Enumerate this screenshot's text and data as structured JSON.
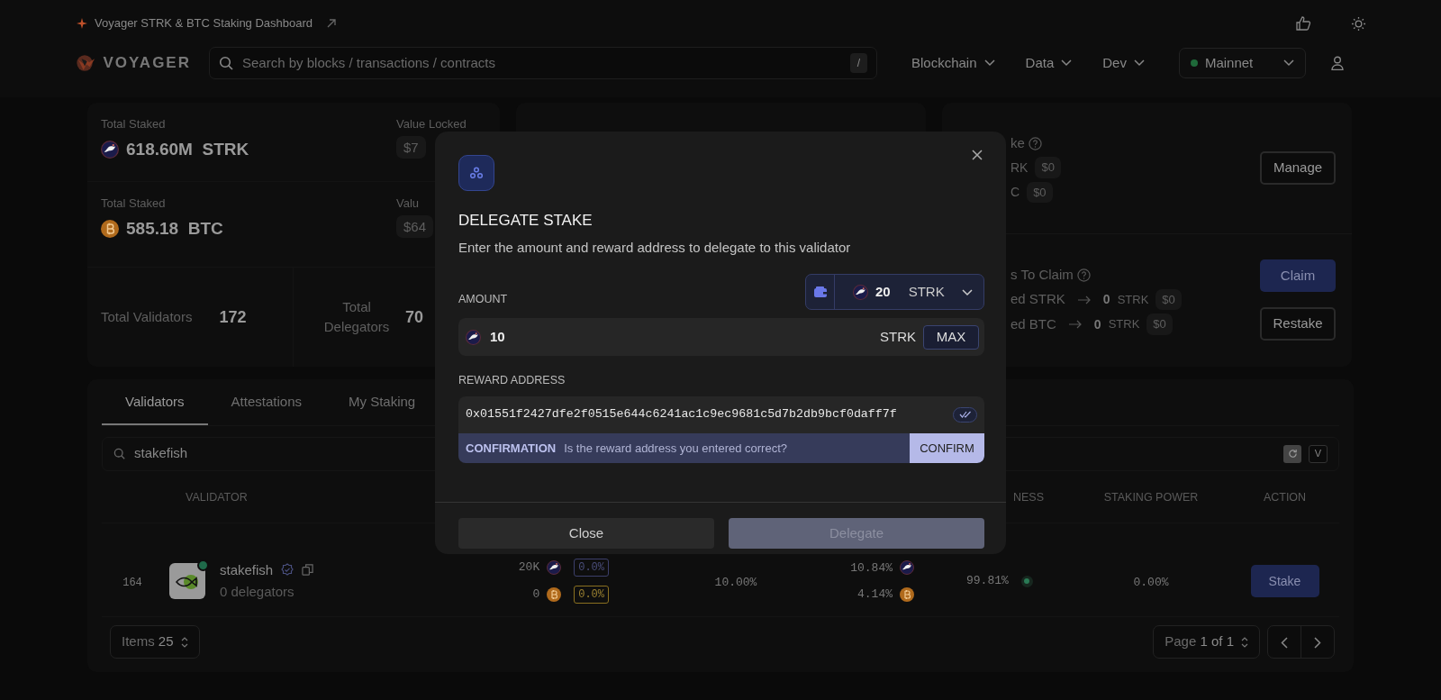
{
  "header": {
    "banner": "Voyager STRK & BTC Staking Dashboard",
    "logo_text": "VOYAGER",
    "search": {
      "placeholder": "Search by blocks / transactions / contracts",
      "shortcut": "/"
    },
    "nav": [
      "Blockchain",
      "Data",
      "Dev"
    ],
    "network": {
      "label": "Mainnet",
      "connected": true
    }
  },
  "stats": {
    "strk": {
      "label": "Total Staked",
      "value": "618.60M",
      "unit": "STRK",
      "value_label": "Value Locked",
      "value_locked": "$7"
    },
    "btc": {
      "label": "Total Staked",
      "value": "585.18",
      "unit": "BTC",
      "value_label": "Valu",
      "value_locked": "$64"
    },
    "validators": {
      "label": "Total Validators",
      "value": "172"
    },
    "delegators": {
      "label": "Total Delegators",
      "value": "70"
    }
  },
  "my_stake": {
    "title": "ke",
    "rows": [
      {
        "unit": "RK",
        "usd": "$0"
      },
      {
        "unit": "C",
        "usd": "$0"
      }
    ],
    "button": "Manage"
  },
  "rewards": {
    "title": "s To Claim",
    "rows": [
      {
        "label": "ed STRK",
        "amount": "0",
        "unit": "STRK",
        "usd": "$0"
      },
      {
        "label": "ed BTC",
        "amount": "0",
        "unit": "STRK",
        "usd": "$0"
      }
    ],
    "claim": "Claim",
    "restake": "Restake"
  },
  "tabs": [
    {
      "label": "Validators",
      "selected": true
    },
    {
      "label": "Attestations",
      "selected": false
    },
    {
      "label": "My Staking",
      "selected": false
    }
  ],
  "filter": {
    "value": "stakefish",
    "toggle": "V"
  },
  "table": {
    "columns": [
      "VALIDATOR",
      "NESS",
      "STAKING POWER",
      "ACTION"
    ],
    "rows": [
      {
        "rank": "164",
        "name": "stakefish",
        "verified": true,
        "online": true,
        "delegators": "0 delegators",
        "stakes": [
          {
            "amount": "20K",
            "kind": "strk",
            "share": "0.0%"
          },
          {
            "amount": "0",
            "kind": "btc",
            "share": "0.0%"
          }
        ],
        "commission": "10.00%",
        "apr": [
          {
            "value": "10.84%",
            "kind": "strk"
          },
          {
            "value": "4.14%",
            "kind": "btc"
          }
        ],
        "attestation": "99.81%",
        "healthy": true,
        "staking_power": "0.00%",
        "action": "Stake"
      }
    ]
  },
  "pagination": {
    "items_label": "Items",
    "items_value": "25",
    "page_label": "Page",
    "page_value": "1 of 1"
  },
  "modal": {
    "title": "DELEGATE STAKE",
    "subtitle": "Enter the amount and reward address to delegate to this validator",
    "amount_label": "AMOUNT",
    "balance": {
      "value": "20",
      "unit": "STRK"
    },
    "amount": {
      "value": "10",
      "unit": "STRK",
      "max": "MAX"
    },
    "address_label": "REWARD ADDRESS",
    "address": "0x01551f2427dfe2f0515e644c6241ac1c9ec9681c5d7b2db9bcf0daff7f",
    "confirmation": {
      "label": "CONFIRMATION",
      "question": "Is the reward address you entered correct?",
      "button": "CONFIRM"
    },
    "buttons": [
      {
        "label": "Close",
        "disabled": false
      },
      {
        "label": "Delegate",
        "disabled": true
      }
    ]
  }
}
